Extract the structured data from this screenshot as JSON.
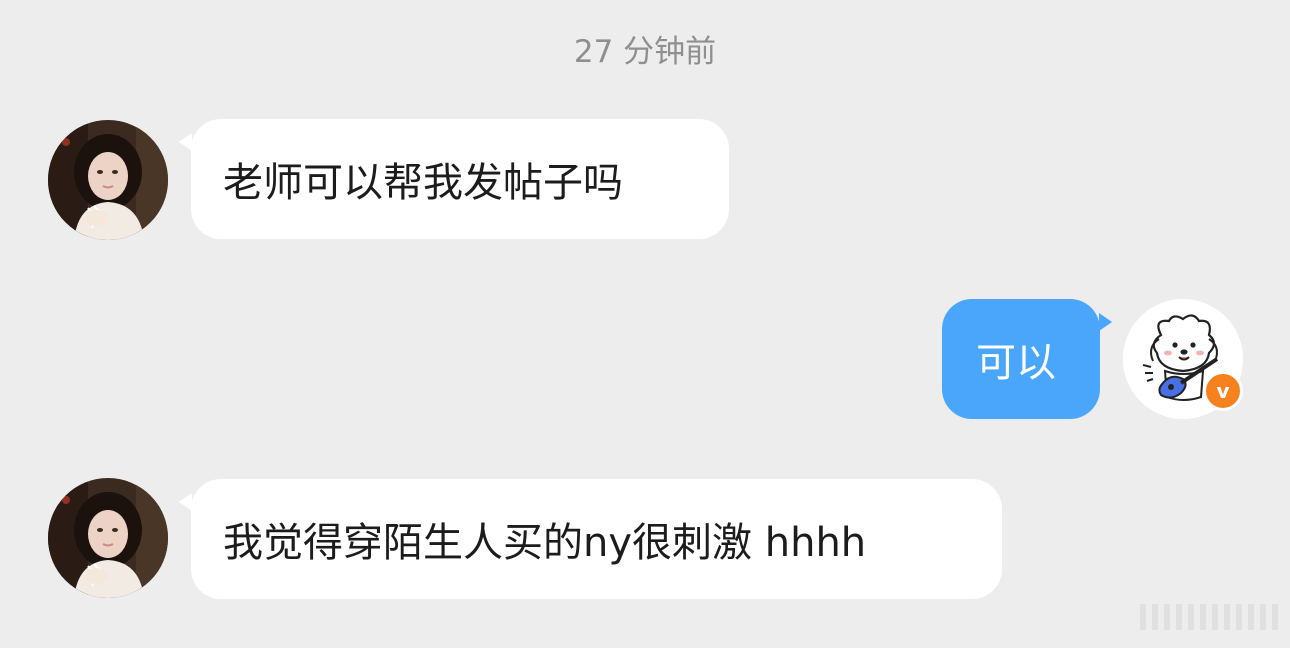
{
  "conversation": {
    "timestamp": "27 分钟前",
    "messages": [
      {
        "sender": "other",
        "avatar_icon": "user-avatar-icon",
        "text": "老师可以帮我发帖子吗"
      },
      {
        "sender": "self",
        "avatar_icon": "dog-guitar-avatar-icon",
        "badge": "v",
        "text": "可以"
      },
      {
        "sender": "other",
        "avatar_icon": "user-avatar-icon",
        "text": "我觉得穿陌生人买的ny很刺激 hhhh"
      }
    ]
  },
  "colors": {
    "background": "#ededed",
    "incoming_bubble": "#ffffff",
    "outgoing_bubble": "#4aa6fb",
    "timestamp_text": "#8f8f8f",
    "verified_badge": "#f5821f"
  }
}
